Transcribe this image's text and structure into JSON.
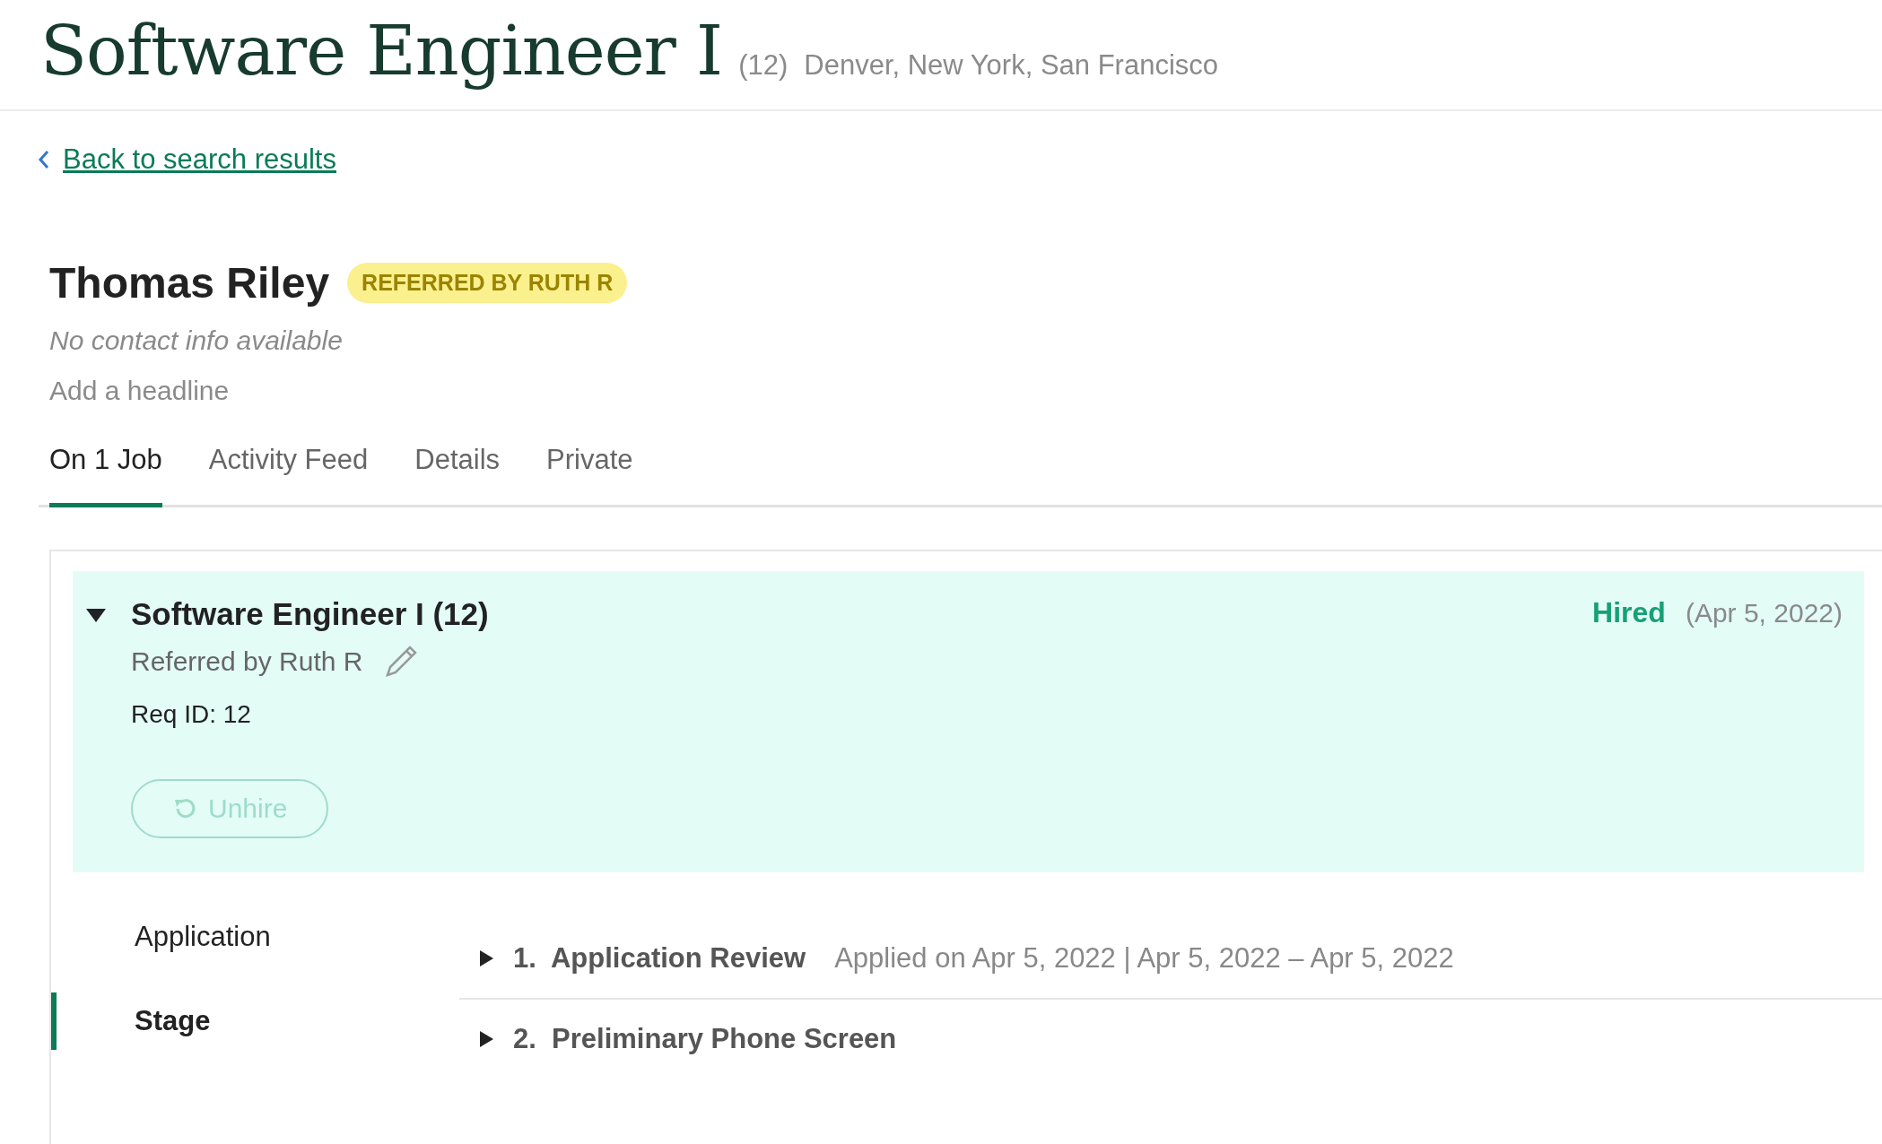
{
  "header": {
    "title": "Software Engineer I",
    "count": "(12)",
    "locations": "Denver, New York, San Francisco"
  },
  "back_link": "Back to search results",
  "candidate": {
    "name": "Thomas Riley",
    "badge": "REFERRED BY RUTH R",
    "contact": "No contact info available",
    "headline_placeholder": "Add a headline"
  },
  "tabs": [
    {
      "label": "On 1 Job",
      "selected": true
    },
    {
      "label": "Activity Feed",
      "selected": false
    },
    {
      "label": "Details",
      "selected": false
    },
    {
      "label": "Private",
      "selected": false
    }
  ],
  "job": {
    "title": "Software Engineer I (12)",
    "expanded": true,
    "referral": "Referred by Ruth R",
    "req_id": "Req ID: 12",
    "status": "Hired",
    "status_date": "(Apr 5, 2022)",
    "unhire_button": "Unhire"
  },
  "nav": [
    {
      "label": "Application",
      "selected": false
    },
    {
      "label": "Stage",
      "selected": true
    }
  ],
  "stages": [
    {
      "number": "1.",
      "name": "Application Review",
      "detail": "Applied on Apr 5, 2022 | Apr 5, 2022 – Apr 5, 2022",
      "expanded": false
    },
    {
      "number": "2.",
      "name": "Preliminary Phone Screen",
      "expanded": false
    }
  ]
}
